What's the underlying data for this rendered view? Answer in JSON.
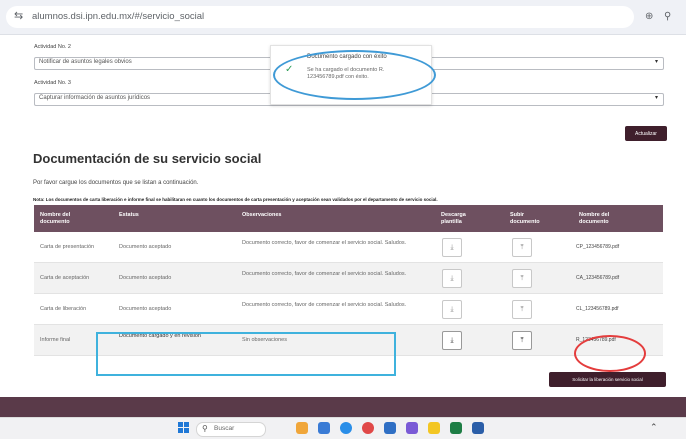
{
  "browser": {
    "url": "alumnos.dsi.ipn.edu.mx/#/servicio_social",
    "icons": [
      "site-settings-icon",
      "profile-icon",
      "search-icon"
    ]
  },
  "form": {
    "actividad2_label": "Actividad No. 2",
    "actividad2_value": "Notificar de asuntos legales obvios",
    "actividad3_label": "Actividad No. 3",
    "actividad3_value": "Capturar información de asuntos jurídicos",
    "actualizar_label": "Actualizar"
  },
  "toast": {
    "title": "Documento cargado con éxito",
    "message": "Se ha cargado el documento R. 123456789.pdf con éxito."
  },
  "documentation": {
    "title": "Documentación de su servicio social",
    "subtitle": "Por favor cargue los documentos que se listan a continuación.",
    "note": "Nota: Los documentos de carta liberación e informe final se habilitaran en cuanto los documentos de carta presentación y aceptación sean validados por el departamento de servicio social.",
    "headers": [
      "Nombre del documento",
      "Estatus",
      "Observaciones",
      "Descarga plantilla",
      "Subir documento",
      "Nombre del documento"
    ],
    "rows": [
      {
        "name": "Carta de presentación",
        "status": "Documento aceptado",
        "obs": "Documento correcto, favor de comenzar el servicio social. Saludos.",
        "file": "CP_123456789.pdf"
      },
      {
        "name": "Carta de aceptación",
        "status": "Documento aceptado",
        "obs": "Documento correcto, favor de comenzar el servicio social. Saludos.",
        "file": "CA_123456789.pdf"
      },
      {
        "name": "Carta de liberación",
        "status": "Documento aceptado",
        "obs": "Documento correcto, favor de comenzar el servicio social. Saludos.",
        "file": "CL_123456789.pdf"
      },
      {
        "name": "Informe final",
        "status": "Documento cargado y en revisión",
        "obs": "Sin observaciones",
        "file": "R_123456789.pdf"
      }
    ],
    "solicitar_label": "Solicitar la liberación servicio social"
  },
  "taskbar": {
    "search_placeholder": "Buscar"
  },
  "colors": {
    "header_bg": "#6e5060",
    "button_bg": "#3f1f2c",
    "footer_bg": "#5a3a49",
    "success": "#2e9e57",
    "annotation_blue": "#3fb2dd",
    "annotation_red": "#e43d3d"
  }
}
